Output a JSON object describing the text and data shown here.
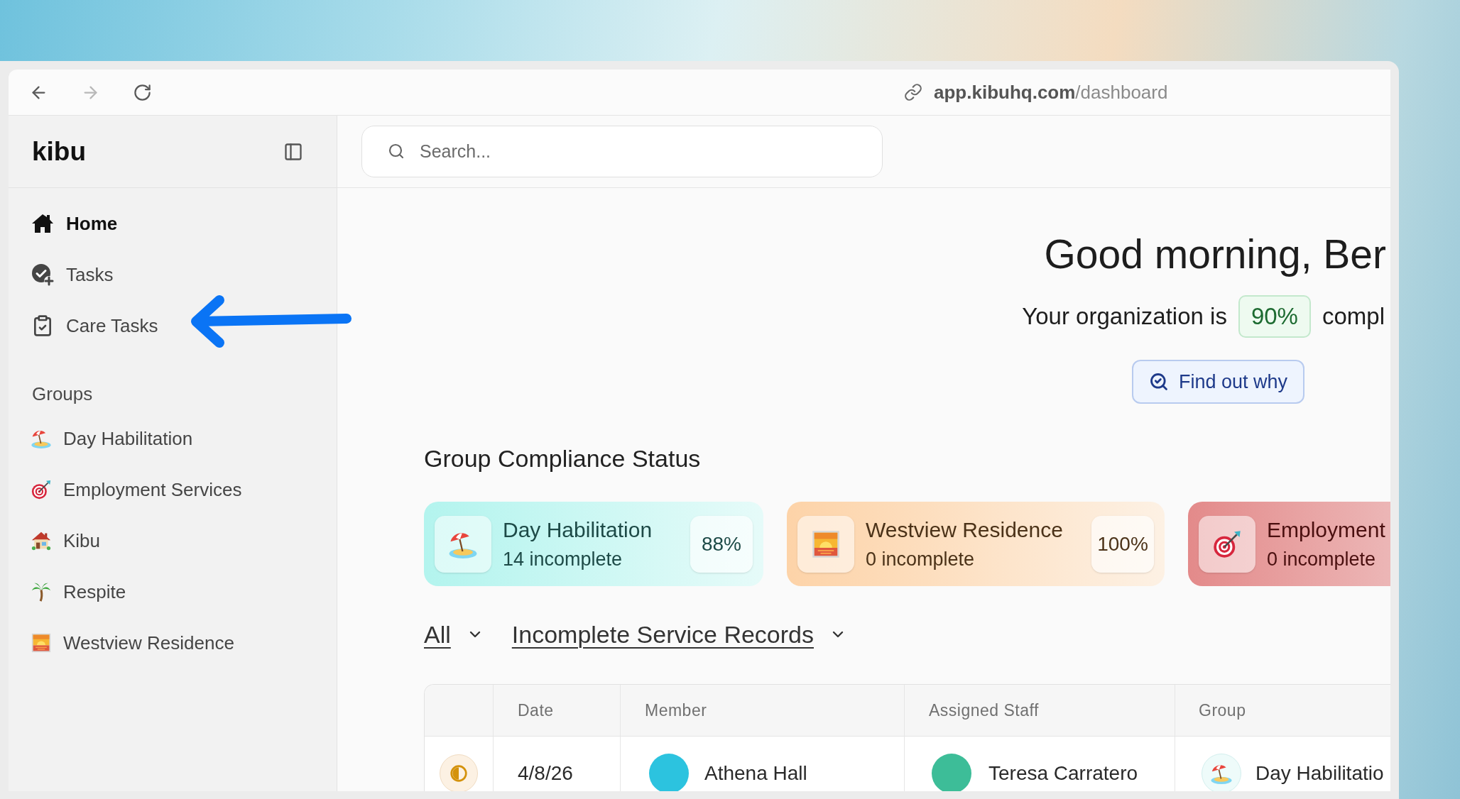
{
  "browser": {
    "nav_buttons": [
      {
        "kind": "back",
        "disabled": false
      },
      {
        "kind": "forward",
        "disabled": true
      },
      {
        "kind": "reload",
        "disabled": false
      }
    ],
    "url_host": "app.kibuhq.com",
    "url_path": "/dashboard"
  },
  "sidebar": {
    "logo": "kibu",
    "nav": [
      {
        "label": "Home",
        "kind": "home",
        "selected": true
      },
      {
        "label": "Tasks",
        "kind": "tasks",
        "selected": false
      },
      {
        "label": "Care Tasks",
        "kind": "clipboard",
        "selected": false
      }
    ],
    "groups_heading": "Groups",
    "groups": [
      {
        "label": "Day Habilitation",
        "kind": "beach"
      },
      {
        "label": "Employment Services",
        "kind": "target"
      },
      {
        "label": "Kibu",
        "kind": "house"
      },
      {
        "label": "Respite",
        "kind": "palm"
      },
      {
        "label": "Westview Residence",
        "kind": "sunset"
      }
    ]
  },
  "search": {
    "placeholder": "Search..."
  },
  "hero": {
    "greeting": "Good morning, Ber",
    "summary_before": "Your organization is",
    "score": "90%",
    "summary_after": "compl",
    "button": "Find out why"
  },
  "compliance": {
    "title": "Group Compliance Status",
    "cards": [
      {
        "name": "Day Habilitation",
        "incomplete": "14 incomplete",
        "percent": "88%",
        "kind": "beach",
        "color": "#b3f4ee"
      },
      {
        "name": "Westview Residence",
        "incomplete": "0 incomplete",
        "percent": "100%",
        "kind": "sunset",
        "color": "#fdd3a8"
      },
      {
        "name": "Employment",
        "incomplete": "0 incomplete",
        "kind": "target",
        "color": "#e38a8a"
      }
    ]
  },
  "filters": [
    {
      "label": "All"
    },
    {
      "label": "Incomplete Service Records"
    }
  ],
  "table": {
    "columns": [
      "Date",
      "Member",
      "Assigned Staff",
      "Group"
    ],
    "rows": [
      {
        "date": "4/8/26",
        "member": "Athena Hall",
        "staff": "Teresa Carratero",
        "group": {
          "label": "Day Habilitatio",
          "kind": "beach"
        }
      }
    ]
  }
}
